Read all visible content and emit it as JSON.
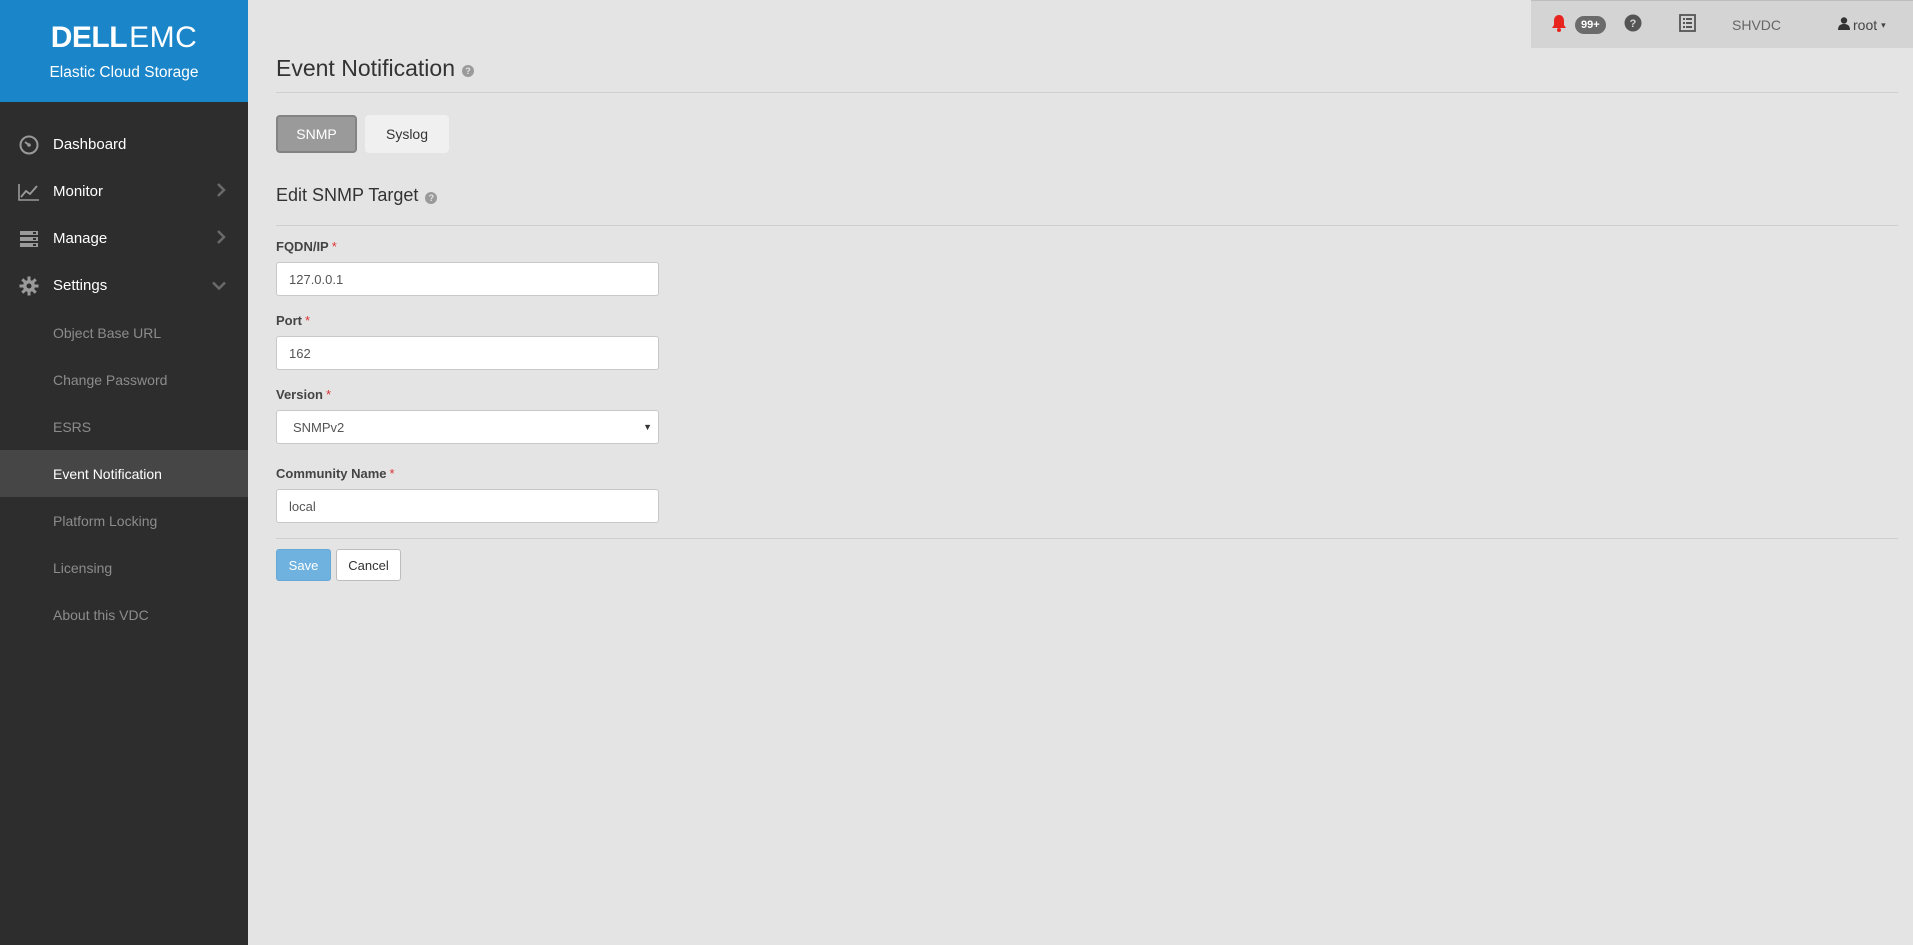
{
  "brand": {
    "logo_dell": "DELL",
    "logo_emc": "EMC",
    "product_name": "Elastic Cloud Storage"
  },
  "sidebar": {
    "items": [
      {
        "label": "Dashboard",
        "icon": "dashboard-icon"
      },
      {
        "label": "Monitor",
        "icon": "line-chart-icon",
        "expandable": true
      },
      {
        "label": "Manage",
        "icon": "server-stack-icon",
        "expandable": true
      },
      {
        "label": "Settings",
        "icon": "gear-icon",
        "expanded": true
      }
    ],
    "settings_subitems": [
      {
        "label": "Object Base URL"
      },
      {
        "label": "Change Password"
      },
      {
        "label": "ESRS"
      },
      {
        "label": "Event Notification",
        "active": true
      },
      {
        "label": "Platform Locking"
      },
      {
        "label": "Licensing"
      },
      {
        "label": "About this VDC"
      }
    ]
  },
  "topbar": {
    "alerts_badge": "99+",
    "vdc_name": "SHVDC",
    "user": "root",
    "alert_color": "#e8241f"
  },
  "page": {
    "title": "Event Notification",
    "tabs": {
      "snmp": "SNMP",
      "syslog": "Syslog"
    },
    "section_title": "Edit SNMP Target"
  },
  "form": {
    "fqdn_label": "FQDN/IP",
    "fqdn_value": "127.0.0.1",
    "port_label": "Port",
    "port_value": "162",
    "version_label": "Version",
    "version_value": "SNMPv2",
    "community_label": "Community Name",
    "community_value": "local",
    "required_mark": "*"
  },
  "buttons": {
    "save": "Save",
    "cancel": "Cancel"
  },
  "colors": {
    "brand_blue": "#1a85c8",
    "sidebar_bg": "#2d2d2d",
    "save_blue": "#6fb1df",
    "required_red": "#d33333"
  }
}
